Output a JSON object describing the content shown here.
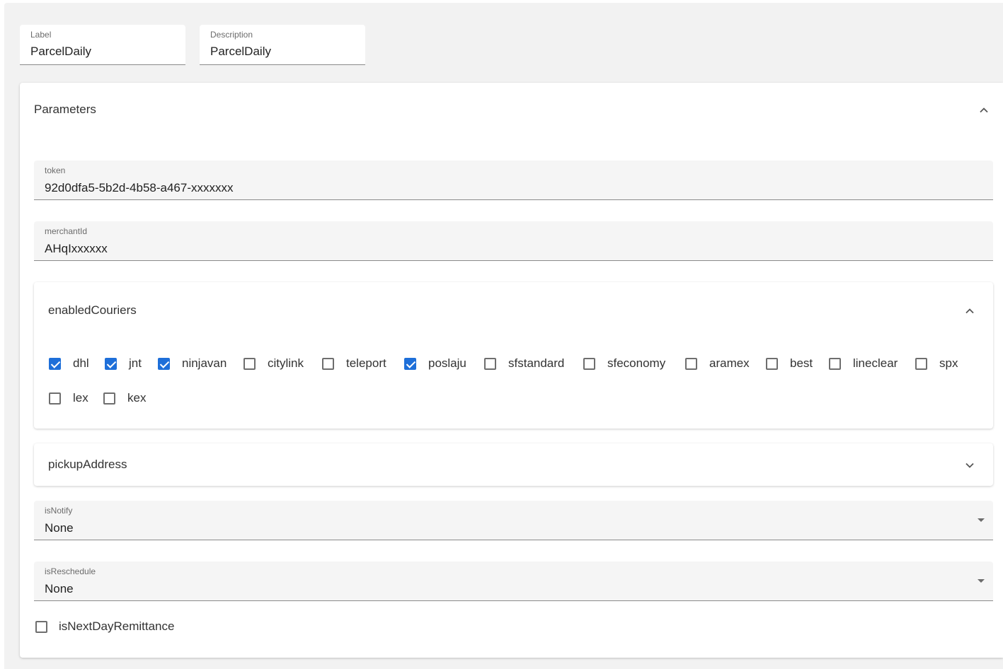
{
  "top_fields": {
    "label": {
      "label": "Label",
      "value": "ParcelDaily"
    },
    "description": {
      "label": "Description",
      "value": "ParcelDaily"
    }
  },
  "parameters": {
    "title": "Parameters",
    "token": {
      "label": "token",
      "value": "92d0dfa5-5b2d-4b58-a467-xxxxxxx"
    },
    "merchant_id": {
      "label": "merchantId",
      "value": "AHqIxxxxxx"
    },
    "enabled_couriers": {
      "title": "enabledCouriers",
      "items": [
        {
          "label": "dhl",
          "checked": true
        },
        {
          "label": "jnt",
          "checked": true
        },
        {
          "label": "ninjavan",
          "checked": true
        },
        {
          "label": "citylink",
          "checked": false
        },
        {
          "label": "teleport",
          "checked": false
        },
        {
          "label": "poslaju",
          "checked": true
        },
        {
          "label": "sfstandard",
          "checked": false
        },
        {
          "label": "sfeconomy",
          "checked": false
        },
        {
          "label": "aramex",
          "checked": false
        },
        {
          "label": "best",
          "checked": false
        },
        {
          "label": "lineclear",
          "checked": false
        },
        {
          "label": "spx",
          "checked": false
        },
        {
          "label": "lex",
          "checked": false
        },
        {
          "label": "kex",
          "checked": false
        }
      ]
    },
    "pickup_address": {
      "title": "pickupAddress"
    },
    "is_notify": {
      "label": "isNotify",
      "value": "None"
    },
    "is_reschedule": {
      "label": "isReschedule",
      "value": "None"
    },
    "is_next_day_remittance": {
      "label": "isNextDayRemittance",
      "checked": false
    }
  },
  "colors": {
    "accent": "#1e6fd9",
    "background": "#f2f2f2"
  },
  "icons": [
    "chevron-up-icon",
    "chevron-down-icon",
    "dropdown-arrow-icon",
    "checkbox-icon"
  ]
}
